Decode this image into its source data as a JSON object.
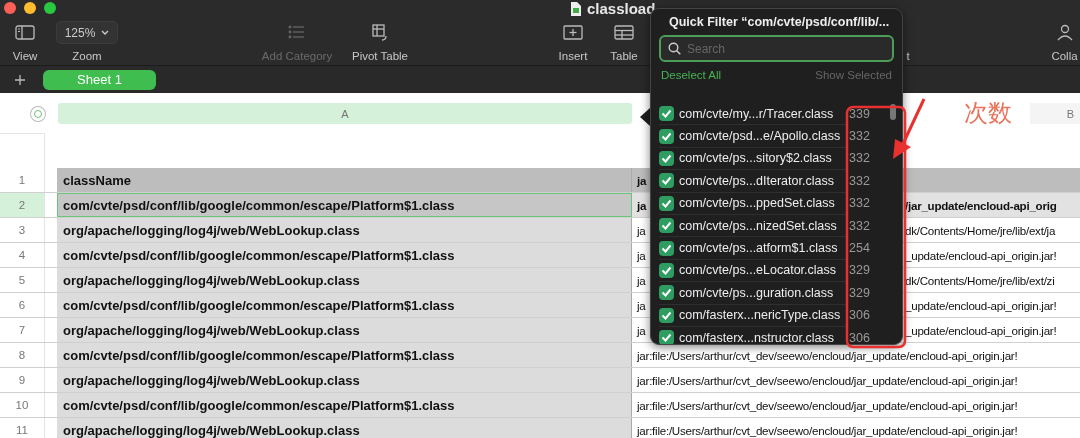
{
  "window": {
    "title": "classload"
  },
  "toolbar": [
    {
      "label": "View",
      "kind": "button",
      "disabled": false
    },
    {
      "label": "Zoom",
      "kind": "dropdown",
      "value": "125%",
      "disabled": false
    },
    {
      "label": "Add Category",
      "kind": "button",
      "disabled": true
    },
    {
      "label": "Pivot Table",
      "kind": "button",
      "disabled": false
    },
    {
      "label": "Insert",
      "kind": "button",
      "disabled": false
    },
    {
      "label": "Table",
      "kind": "button",
      "disabled": false
    },
    {
      "label": "t",
      "kind": "label",
      "disabled": false
    },
    {
      "label": "Colla",
      "kind": "button",
      "disabled": false
    }
  ],
  "sheet_tabs": [
    {
      "label": "Sheet 1",
      "selected": true
    }
  ],
  "column_headers": [
    {
      "label": "A",
      "selected": true
    },
    {
      "label": "B",
      "selected": false
    }
  ],
  "rows": [
    {
      "number": "1",
      "kind": "header",
      "selected": false,
      "column_a": "className",
      "column_b": {
        "before_popover": "ja"
      }
    },
    {
      "number": "2",
      "kind": "data",
      "selected": true,
      "column_a": "com/cvte/psd/conf/lib/google/common/escape/Platform$1.class",
      "column_b": {
        "before_popover": "ja",
        "after_popover": "/jar_update/encloud-api_orig"
      }
    },
    {
      "number": "3",
      "kind": "data",
      "selected": false,
      "column_a": "org/apache/logging/log4j/web/WebLookup.class",
      "column_b": {
        "before_popover": "ja",
        "after_popover": "dk/Contents/Home/jre/lib/ext/ja"
      }
    },
    {
      "number": "4",
      "kind": "data",
      "selected": false,
      "column_a": "com/cvte/psd/conf/lib/google/common/escape/Platform$1.class",
      "column_b": {
        "before_popover": "ja",
        "after_popover": "_update/encloud-api_origin.jar!"
      }
    },
    {
      "number": "5",
      "kind": "data",
      "selected": false,
      "column_a": "org/apache/logging/log4j/web/WebLookup.class",
      "column_b": {
        "before_popover": "ja",
        "after_popover": "dk/Contents/Home/jre/lib/ext/zi"
      }
    },
    {
      "number": "6",
      "kind": "data",
      "selected": false,
      "column_a": "com/cvte/psd/conf/lib/google/common/escape/Platform$1.class",
      "column_b": {
        "before_popover": "ja",
        "after_popover": "_update/encloud-api_origin.jar!"
      }
    },
    {
      "number": "7",
      "kind": "data",
      "selected": false,
      "column_a": "org/apache/logging/log4j/web/WebLookup.class",
      "column_b": {
        "before_popover": "ja",
        "after_popover": "_update/encloud-api_origin.jar!"
      }
    },
    {
      "number": "8",
      "kind": "data",
      "selected": false,
      "column_a": "com/cvte/psd/conf/lib/google/common/escape/Platform$1.class",
      "column_b": {
        "text": "jar:file:/Users/arthur/cvt_dev/seewo/encloud/jar_update/encloud-api_origin.jar!"
      }
    },
    {
      "number": "9",
      "kind": "data",
      "selected": false,
      "column_a": "org/apache/logging/log4j/web/WebLookup.class",
      "column_b": {
        "text": "jar:file:/Users/arthur/cvt_dev/seewo/encloud/jar_update/encloud-api_origin.jar!"
      }
    },
    {
      "number": "10",
      "kind": "data",
      "selected": false,
      "column_a": "com/cvte/psd/conf/lib/google/common/escape/Platform$1.class",
      "column_b": {
        "text": "jar:file:/Users/arthur/cvt_dev/seewo/encloud/jar_update/encloud-api_origin.jar!"
      }
    },
    {
      "number": "11",
      "kind": "data",
      "selected": false,
      "column_a": "org/apache/logging/log4j/web/WebLookup.class",
      "column_b": {
        "text": "jar:file:/Users/arthur/cvt_dev/seewo/encloud/jar_update/encloud-api_origin.jar!"
      }
    }
  ],
  "quick_filter": {
    "title": "Quick Filter “com/cvte/psd/conf/lib/...",
    "search": {
      "placeholder": "Search"
    },
    "deselect_all": "Deselect All",
    "show_selected": {
      "label": "Show Selected",
      "disabled": true
    },
    "items": [
      {
        "label": "com/cvte/my...r/Tracer.class",
        "count": "339",
        "checked": true
      },
      {
        "label": "com/cvte/psd...e/Apollo.class",
        "count": "332",
        "checked": true
      },
      {
        "label": "com/cvte/ps...sitory$2.class",
        "count": "332",
        "checked": true
      },
      {
        "label": "com/cvte/ps...dIterator.class",
        "count": "332",
        "checked": true
      },
      {
        "label": "com/cvte/ps...ppedSet.class",
        "count": "332",
        "checked": true
      },
      {
        "label": "com/cvte/ps...nizedSet.class",
        "count": "332",
        "checked": true
      },
      {
        "label": "com/cvte/ps...atform$1.class",
        "count": "254",
        "checked": true
      },
      {
        "label": "com/cvte/ps...eLocator.class",
        "count": "329",
        "checked": true
      },
      {
        "label": "com/cvte/ps...guration.class",
        "count": "329",
        "checked": true
      },
      {
        "label": "com/fasterx...nericType.class",
        "count": "306",
        "checked": true
      },
      {
        "label": "com/fasterx...nstructor.class",
        "count": "306",
        "checked": true
      }
    ]
  },
  "annotation": {
    "label": "次数"
  }
}
